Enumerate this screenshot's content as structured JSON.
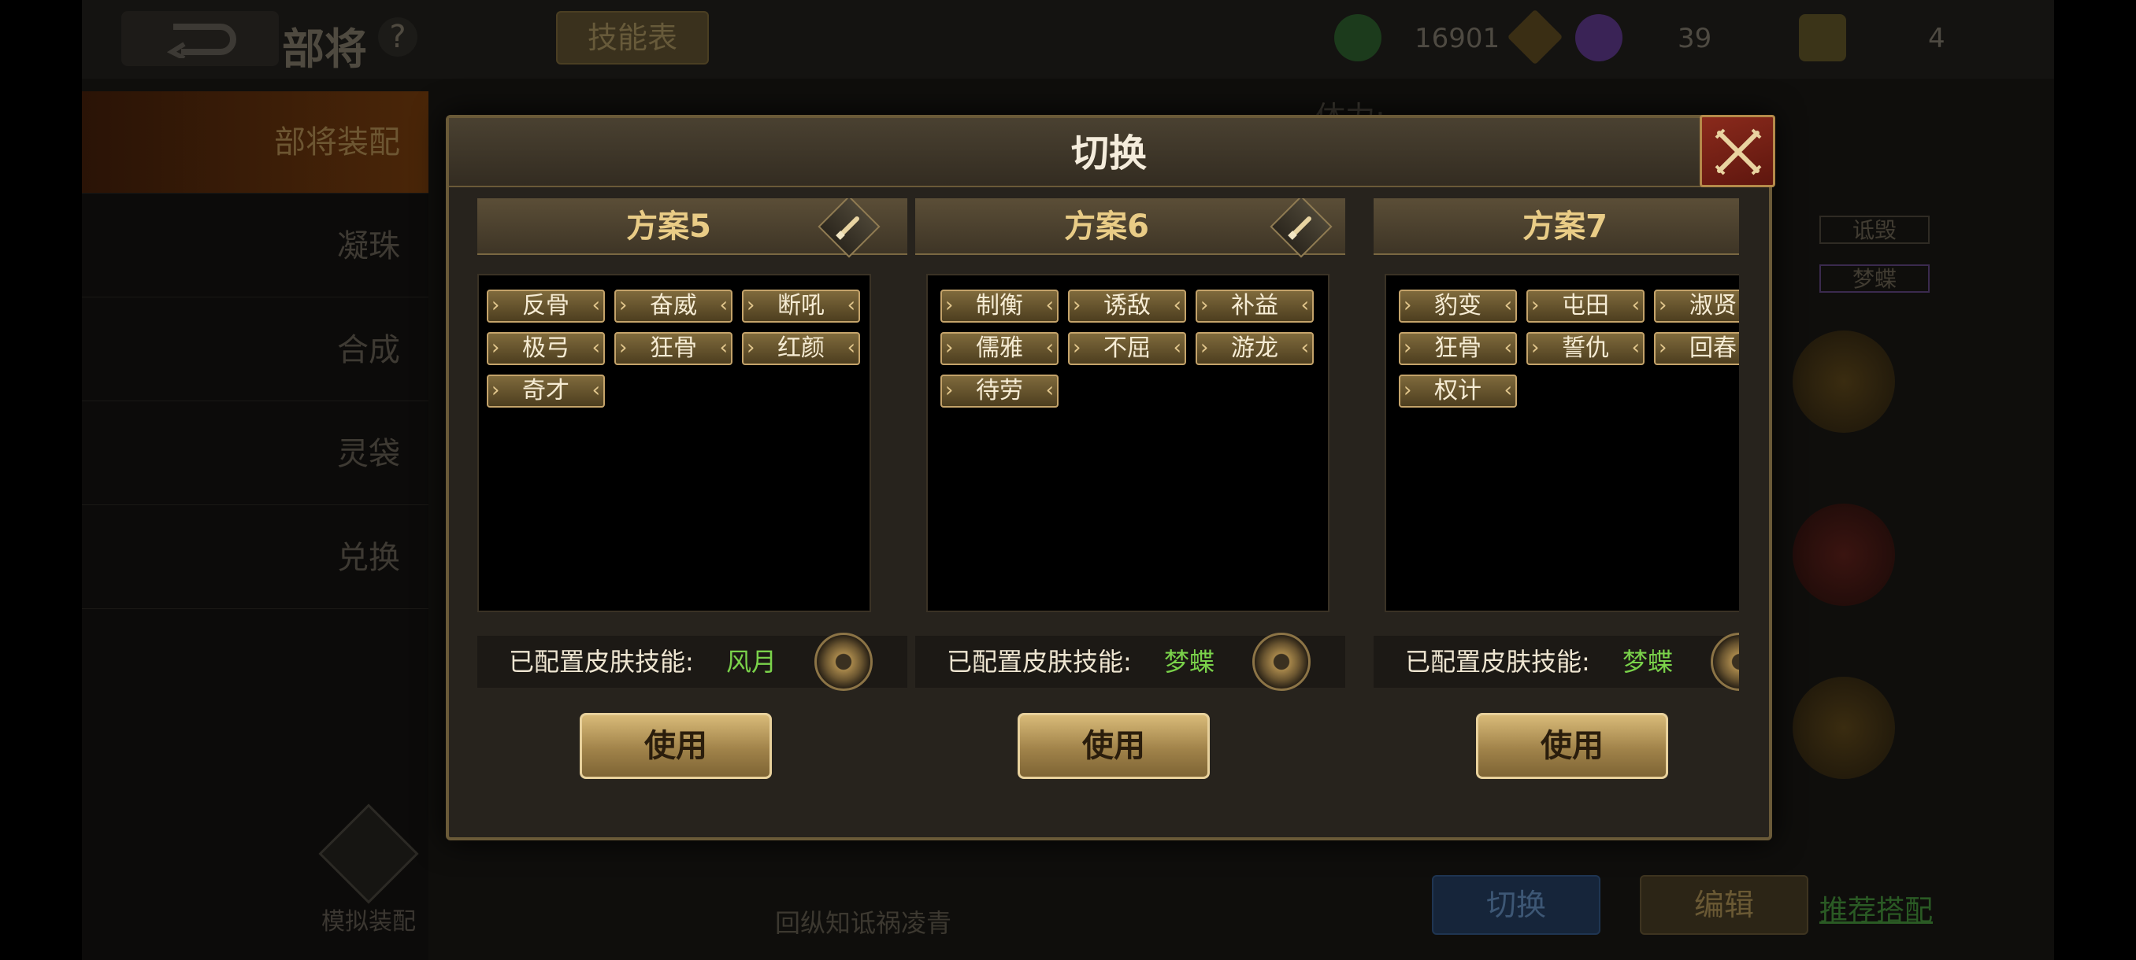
{
  "background": {
    "page_title": "部将",
    "help_icon": "?",
    "skill_table_button": "技能表",
    "resources": {
      "jade": "16901",
      "soul": "39",
      "gift": "4"
    },
    "stamina_label": "体力:",
    "nav_items": [
      "部将装配",
      "凝珠",
      "合成",
      "灵袋",
      "兑换"
    ],
    "simulate_equip": "模拟装配",
    "bottom_caption": "回纵知诋祸凌青",
    "bottom_buttons": {
      "switch": "切换",
      "edit": "编辑",
      "recommend": "推荐搭配"
    },
    "right_tags": [
      "诋毁",
      "梦蝶"
    ]
  },
  "dialog": {
    "title": "切换",
    "skin_label": "已配置皮肤技能:",
    "use_label": "使用",
    "plans": [
      {
        "title": "方案5",
        "skills": [
          "反骨",
          "奋威",
          "断吼",
          "极弓",
          "狂骨",
          "红颜",
          "奇才"
        ],
        "skin_skill": "风月"
      },
      {
        "title": "方案6",
        "skills": [
          "制衡",
          "诱敌",
          "补益",
          "儒雅",
          "不屈",
          "游龙",
          "待劳"
        ],
        "skin_skill": "梦蝶"
      },
      {
        "title": "方案7",
        "skills": [
          "豹变",
          "屯田",
          "淑贤",
          "狂骨",
          "誓仇",
          "回春",
          "权计"
        ],
        "skin_skill": "梦蝶"
      }
    ]
  }
}
